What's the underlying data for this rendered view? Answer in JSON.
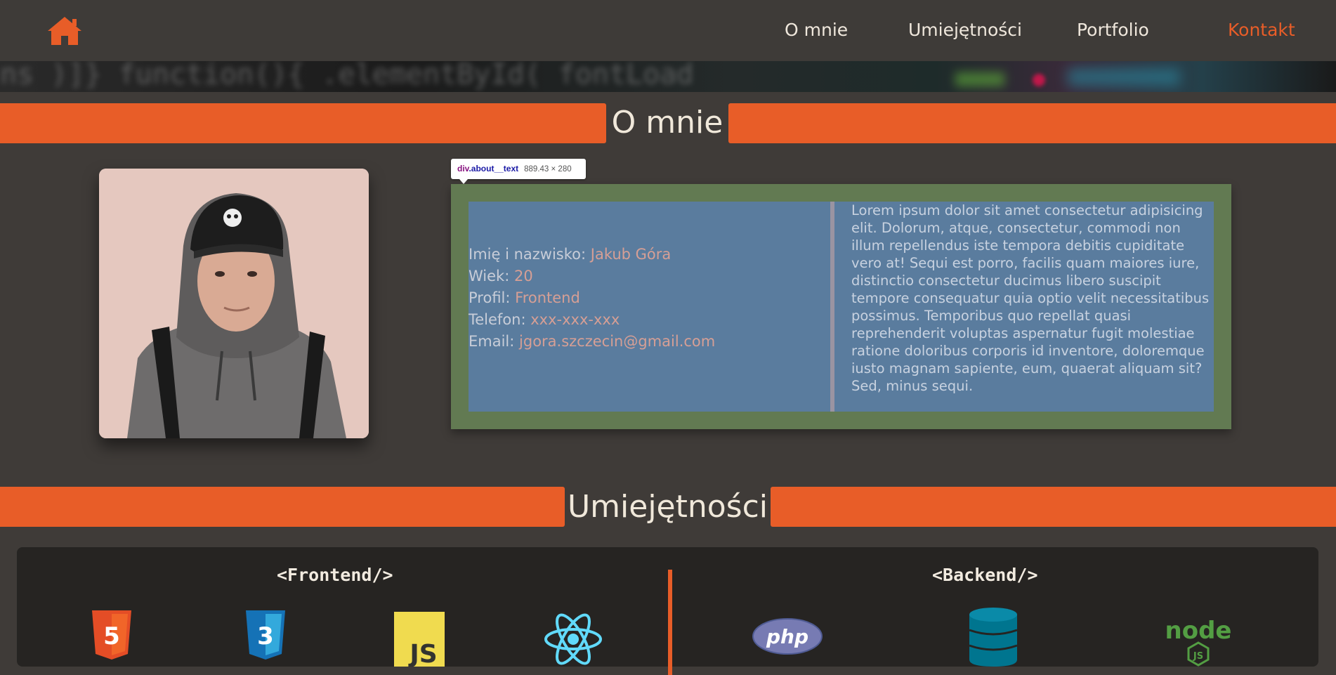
{
  "nav": {
    "home_icon": "home-icon",
    "links": [
      "O mnie",
      "Umiejętności",
      "Portfolio",
      "Kontakt"
    ],
    "active": "Kontakt",
    "accent": "#e85d28"
  },
  "hero": {
    "code": "ns  )]}    function(){  .elementById(  fontLoad"
  },
  "sections": {
    "about_title": "O mnie",
    "skills_title": "Umiejętności"
  },
  "devtools_tooltip": {
    "tag": "div",
    "class": ".about__text",
    "size": "889.43 × 280"
  },
  "about": {
    "photo_icon": "profile-photo",
    "info": [
      {
        "label": "Imię i nazwisko:",
        "value": "Jakub Góra"
      },
      {
        "label": "Wiek:",
        "value": "20"
      },
      {
        "label": "Profil:",
        "value": "Frontend"
      },
      {
        "label": "Telefon:",
        "value": "xxx-xxx-xxx"
      },
      {
        "label": "Email:",
        "value": "jgora.szczecin@gmail.com"
      }
    ],
    "description": "Lorem ipsum dolor sit amet consectetur adipisicing elit. Dolorum, atque, consectetur, commodi non illum repellendus iste tempora debitis cupiditate vero at! Sequi est porro, facilis quam maiores iure, distinctio consectetur ducimus libero suscipit tempore consequatur quia optio velit necessitatibus possimus. Temporibus quo repellat quasi reprehenderit voluptas aspernatur fugit molestiae ratione doloribus corporis id inventore, doloremque iusto magnam sapiente, eum, quaerat aliquam sit? Sed, minus sequi."
  },
  "skills": {
    "frontend_title": "<Frontend/>",
    "backend_title": "<Backend/>",
    "frontend_icons": [
      "html5-icon",
      "css3-icon",
      "javascript-icon",
      "react-icon"
    ],
    "backend_icons": [
      "php-icon",
      "database-icon",
      "nodejs-icon"
    ],
    "labels": {
      "html": "5",
      "css": "3",
      "js": "JS",
      "php": "php",
      "node": "node",
      "nodejs": "JS"
    }
  }
}
